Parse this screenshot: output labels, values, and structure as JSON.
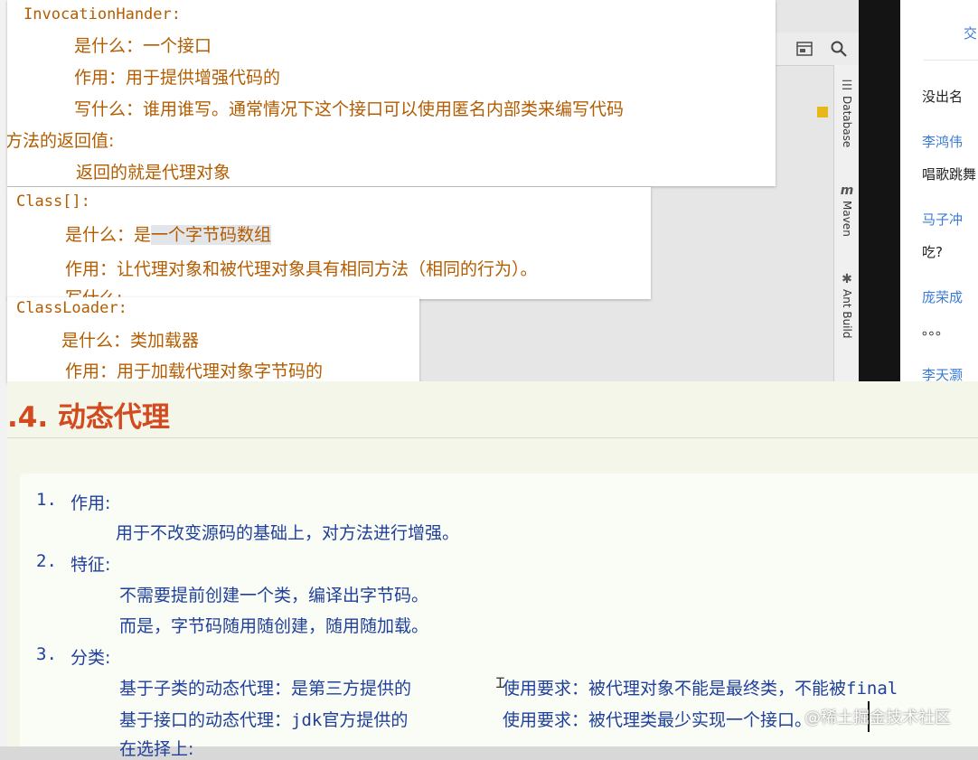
{
  "ide": {
    "tool_tabs": [
      "Database",
      "Maven",
      "Ant Build"
    ]
  },
  "chat": {
    "top_label": "交",
    "items": [
      {
        "type": "msg",
        "text": "没出名"
      },
      {
        "type": "name",
        "text": "李鸿伟"
      },
      {
        "type": "msg",
        "text": "唱歌跳舞"
      },
      {
        "type": "name",
        "text": "马子冲"
      },
      {
        "type": "msg",
        "text": "吃?"
      },
      {
        "type": "name",
        "text": "庞荣成"
      },
      {
        "type": "msg",
        "text": "。。。"
      },
      {
        "type": "name",
        "text": "李天灏"
      }
    ]
  },
  "card1": {
    "title": "InvocationHander:",
    "what": "是什么：一个接口",
    "use": "作用：用于提供增强代码的",
    "write": "写什么：谁用谁写。通常情况下这个接口可以使用匿名内部类来编写代码",
    "ret_label": "方法的返回值:",
    "ret_value": "返回的就是代理对象"
  },
  "card2": {
    "title": "Class[]:",
    "what_prefix": "是什么：是",
    "what_highlight": "一个字节码数组",
    "use": "作用：让代理对象和被代理对象具有相同方法（相同的行为）。",
    "write_partial": "写什么:"
  },
  "card3": {
    "title": "ClassLoader:",
    "what": "是什么：类加载器",
    "use": "作用：用于加载代理对象字节码的"
  },
  "doc": {
    "heading": ".4. 动态代理",
    "s1_num": "1.",
    "s1_title": "作用:",
    "s1_body": "用于不改变源码的基础上，对方法进行增强。",
    "s2_num": "2.",
    "s2_title": "特征:",
    "s2_body1": "不需要提前创建一个类，编译出字节码。",
    "s2_body2": "而是，字节码随用随创建，随用随加载。",
    "s3_num": "3.",
    "s3_title": "分类:",
    "s3_row1_left": "基于子类的动态代理：是第三方提供的",
    "s3_row1_right_pre": "使用要求：被代理对象不能是最终类，不能被",
    "s3_row1_right_code": "final",
    "s3_row2_left_pre": "基于接口的动态代理：",
    "s3_row2_left_code": "jdk",
    "s3_row2_left_post": "官方提供的",
    "s3_row2_right": "使用要求：被代理类最少实现一个接口。",
    "s3_row3_partial": "在选择上:"
  },
  "watermark": "@稀土掘金技术社区"
}
